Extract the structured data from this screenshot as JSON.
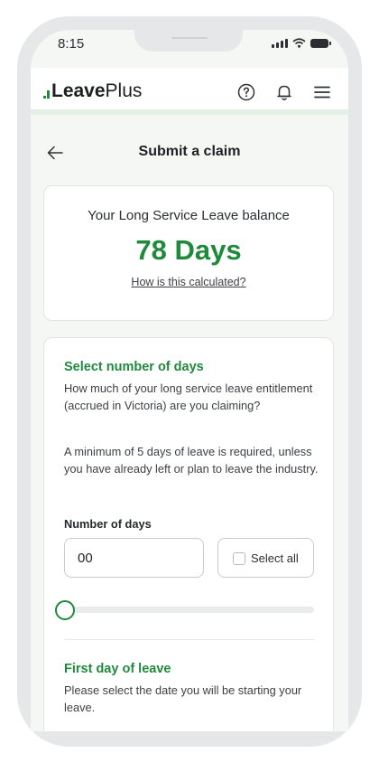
{
  "status_bar": {
    "time": "8:15"
  },
  "header": {
    "brand_prefix": "Leave",
    "brand_suffix": "Plus",
    "icons": [
      "help-icon",
      "bell-icon",
      "menu-icon"
    ]
  },
  "page": {
    "title": "Submit a claim"
  },
  "balance": {
    "label": "Your Long Service Leave balance",
    "value": "78 Days",
    "link": "How is this calculated?"
  },
  "days_section": {
    "title": "Select number of days",
    "description": "How much of your long service leave entitlement (accrued in Victoria) are you claiming?",
    "note": "A minimum of 5 days of leave is required, unless you have already left or plan to leave the industry.",
    "field_label": "Number of days",
    "field_value": "00",
    "select_all_label": "Select all",
    "select_all_checked": false,
    "slider_value": 0
  },
  "first_day_section": {
    "title": "First day of leave",
    "description": "Please select the date you will be starting your leave."
  },
  "colors": {
    "accent": "#1f8a3c",
    "background": "#f4f7f4"
  }
}
